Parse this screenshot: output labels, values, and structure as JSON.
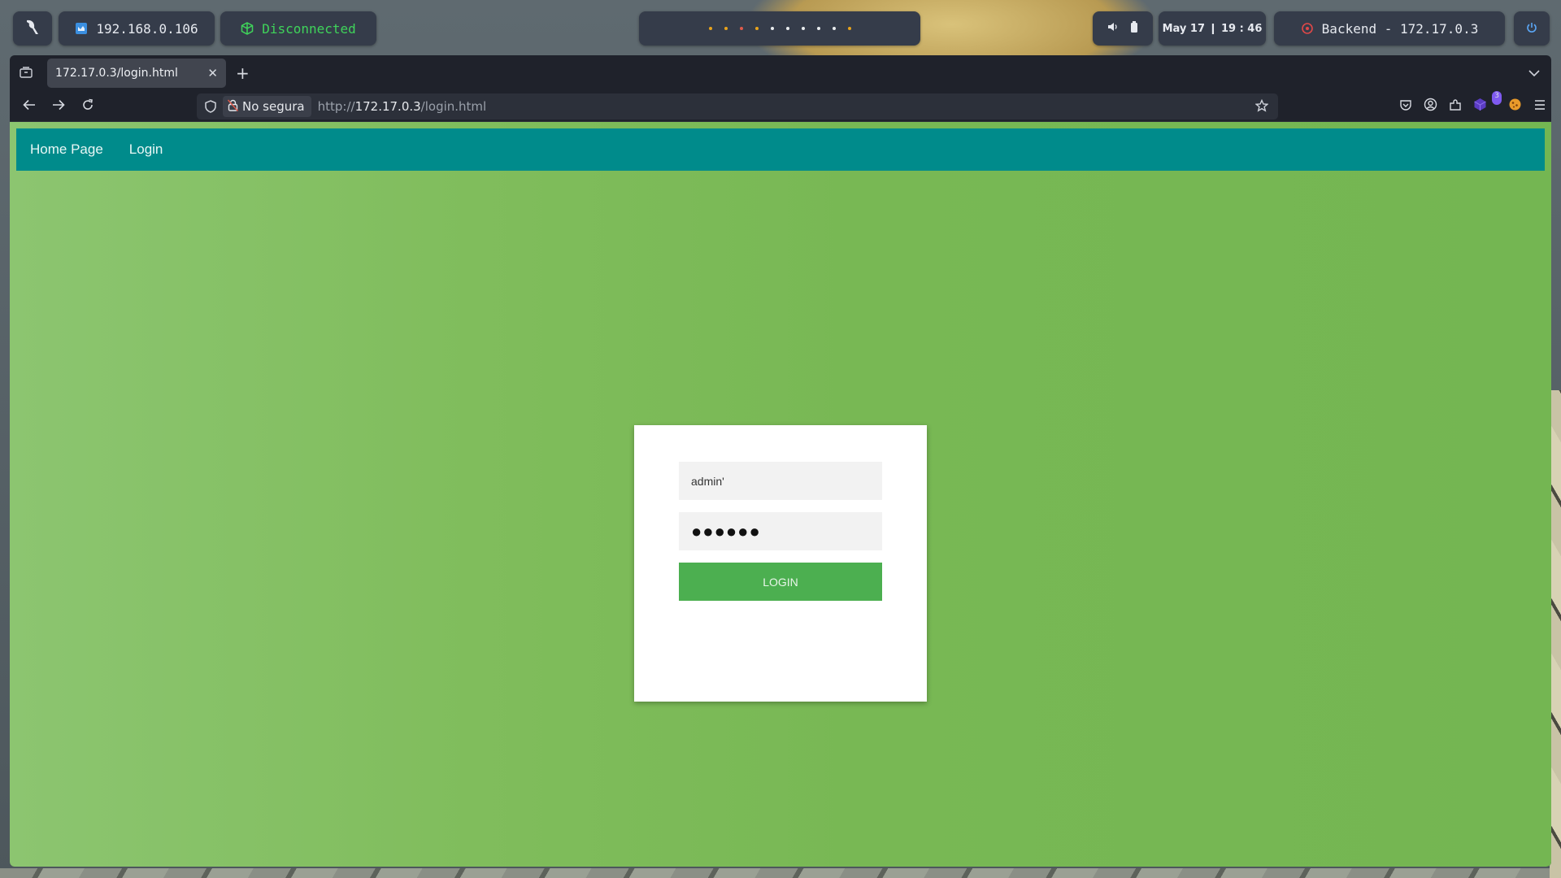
{
  "topbar": {
    "logo_icon": "bird-logo-icon",
    "ip_address": "192.168.0.106",
    "vpn_status": "Disconnected",
    "workspace_dot_colors": [
      "orange",
      "orange",
      "red",
      "orange",
      "white",
      "white",
      "white",
      "white",
      "white",
      "orange"
    ],
    "clock": "May 17 ❙ 19 : 46",
    "target": "Backend - 172.17.0.3"
  },
  "browser": {
    "tab_title": "172.17.0.3/login.html",
    "security_label": "No segura",
    "url_prefix": "http://",
    "url_host": "172.17.0.3",
    "url_path": "/login.html",
    "extension_badge": "3"
  },
  "page": {
    "nav_links": [
      "Home Page",
      "Login"
    ],
    "username_value": "admin'",
    "password_value": "●●●●●●",
    "login_button": "LOGIN"
  },
  "colors": {
    "nav_bg": "#008b8b",
    "page_bg": "#78b854",
    "button_bg": "#4caf50",
    "vpn_status": "#3fd35a"
  }
}
